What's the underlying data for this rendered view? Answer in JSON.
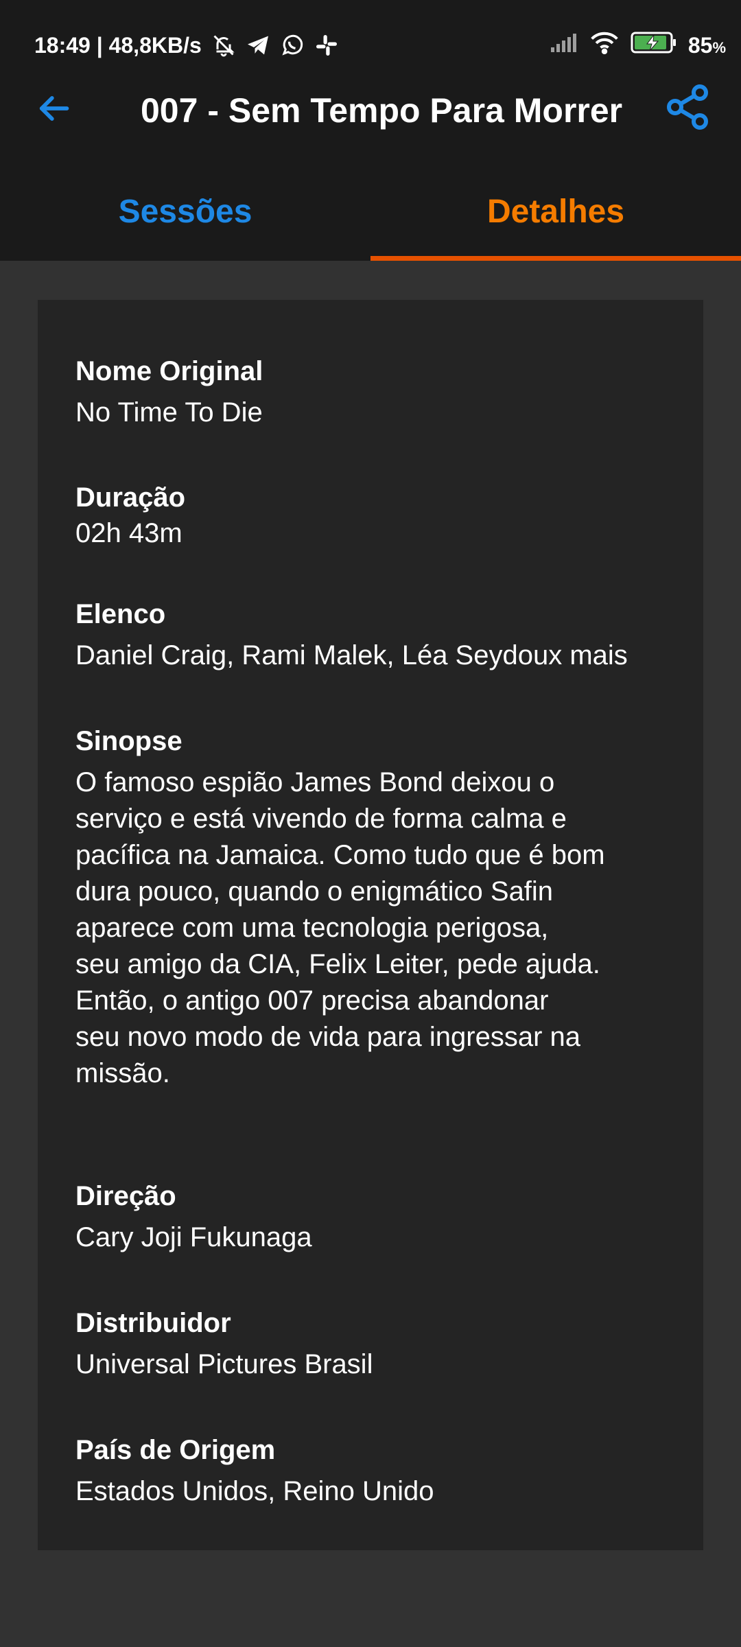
{
  "status_bar": {
    "time_network": "18:49 | 48,8KB/s",
    "battery_percent": "85",
    "battery_unit": "%",
    "icons": [
      "bell-off-icon",
      "telegram-icon",
      "whatsapp-icon",
      "slack-icon",
      "signal-icon",
      "wifi-icon",
      "battery-charging-icon"
    ]
  },
  "toolbar": {
    "title": "007 - Sem Tempo Para Morrer",
    "back_icon": "arrow-left-icon",
    "share_icon": "share-icon"
  },
  "tabs": [
    {
      "label": "Sessões",
      "active": false
    },
    {
      "label": "Detalhes",
      "active": true
    }
  ],
  "details": {
    "original_name": {
      "label": "Nome Original",
      "value": "No Time To Die"
    },
    "duration": {
      "label": "Duração",
      "value": "02h 43m"
    },
    "cast": {
      "label": "Elenco",
      "value": "Daniel Craig, Rami Malek, Léa Seydoux mais"
    },
    "synopsis": {
      "label": "Sinopse",
      "lines": [
        "O famoso espião James Bond deixou o",
        "serviço e está vivendo de forma calma e",
        "pacífica na Jamaica. Como tudo que é bom",
        "dura pouco, quando o enigmático Safin",
        "aparece com uma tecnologia perigosa,",
        "seu amigo da CIA, Felix Leiter, pede ajuda.",
        "Então, o antigo 007 precisa abandonar",
        "seu novo modo de vida para ingressar na",
        "missão."
      ]
    },
    "director": {
      "label": "Direção",
      "value": "Cary Joji Fukunaga"
    },
    "distributor": {
      "label": "Distribuidor",
      "value": "Universal Pictures Brasil"
    },
    "country": {
      "label": "País de Origem",
      "value": "Estados Unidos, Reino Unido"
    }
  },
  "colors": {
    "appbar_bg": "#1a1a1a",
    "page_bg": "#323232",
    "card_bg": "#242424",
    "accent_blue": "#1e88e5",
    "accent_orange": "#f57c00",
    "indicator": "#e65100"
  }
}
